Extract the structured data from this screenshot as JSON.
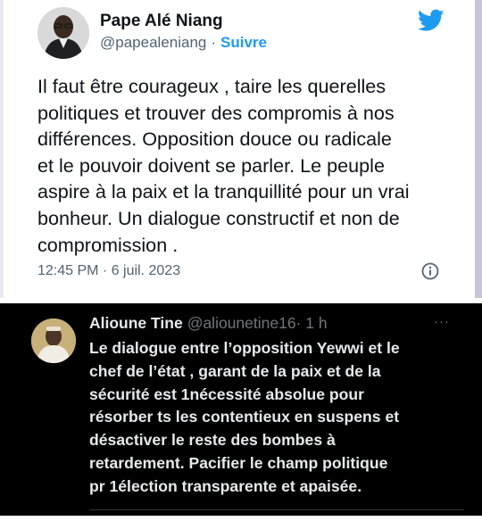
{
  "tweet_top": {
    "name": "Pape Alé Niang",
    "handle": "@papealeniang",
    "separator": "·",
    "follow_label": "Suivre",
    "lines": [
      "Il faut être courageux , taire les querelles",
      "politiques et trouver des compromis à nos",
      "différences. Opposition douce ou radicale",
      "et le pouvoir doivent se parler. Le peuple",
      "aspire à la paix et la tranquillité pour un vrai",
      "bonheur. Un dialogue constructif et non de",
      "compromission ."
    ],
    "timestamp": "12:45 PM · 6 juil. 2023",
    "icons": {
      "logo": "twitter-bird-icon",
      "info": "info-icon"
    },
    "colors": {
      "accent": "#1d9bf0",
      "text": "#0f1419",
      "muted": "#536471"
    }
  },
  "tweet_bottom": {
    "name": "Alioune Tine",
    "handle": "@aliounetine16",
    "time": "· 1 h",
    "more_label": "···",
    "lines": [
      "Le dialogue entre l’opposition Yewwi et le",
      "chef de l’état , garant de la paix et de la",
      "sécurité est 1nécessité absolue pour",
      "résorber ts les contentieux en suspens et",
      "désactiver le reste des bombes à",
      "retardement. Pacifier le champ politique",
      "pr 1élection transparente et apaisée."
    ],
    "icons": {
      "more": "more-options-icon"
    },
    "colors": {
      "background": "#000000",
      "text": "#e7e9ea",
      "muted": "#71767b"
    }
  }
}
